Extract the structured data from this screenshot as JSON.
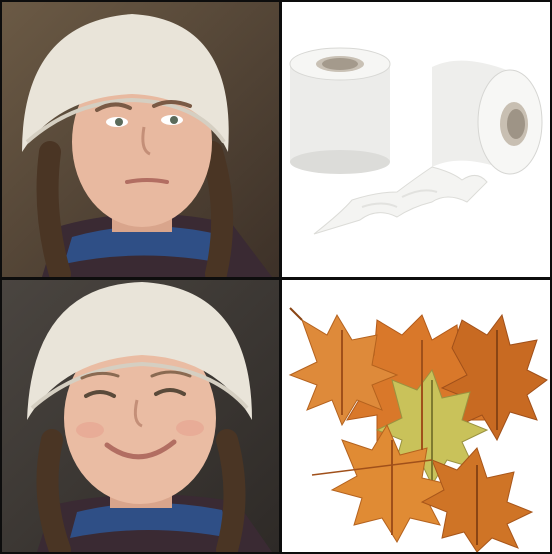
{
  "meme": {
    "panels": [
      {
        "id": "top-left",
        "depicts": "girl-disapproving-face"
      },
      {
        "id": "top-right",
        "depicts": "toilet-paper-rolls"
      },
      {
        "id": "bottom-left",
        "depicts": "girl-smiling-face"
      },
      {
        "id": "bottom-right",
        "depicts": "autumn-oak-leaves"
      }
    ]
  },
  "colors": {
    "border": "#0d0d0d",
    "beanie": "#e9e4d9",
    "skin": "#e8b9a0",
    "hair": "#4a3524",
    "jacket": "#3a2a33",
    "collar": "#2f4f86",
    "paper": "#f3f3f1",
    "leaf_orange": "#d9782a",
    "leaf_yellow": "#c9c25a"
  }
}
